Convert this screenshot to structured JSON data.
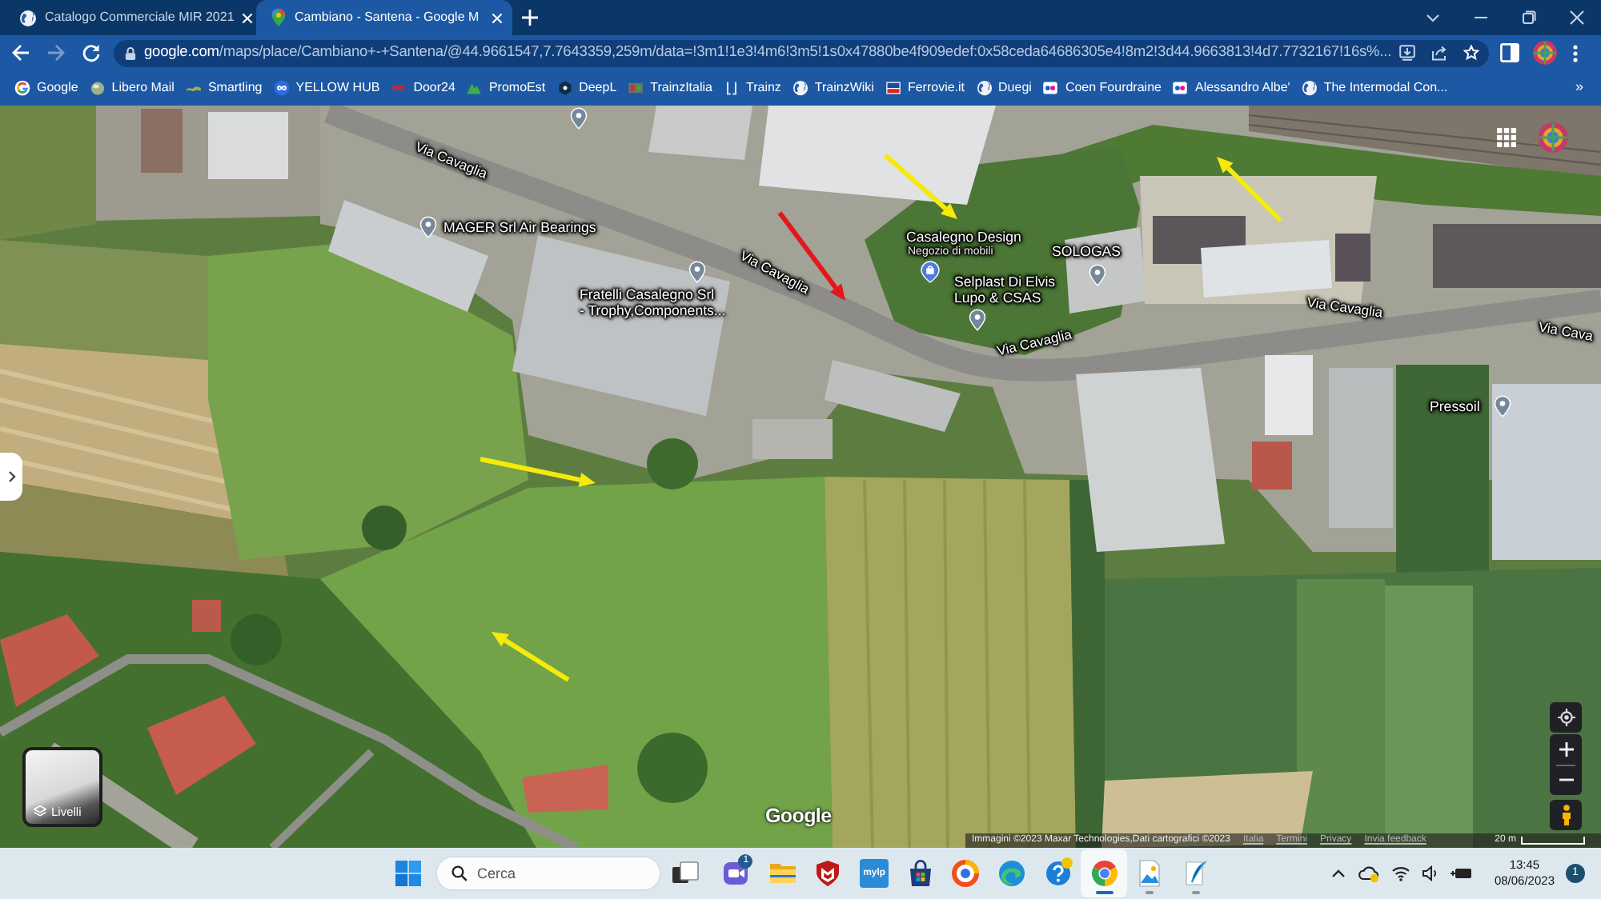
{
  "browser": {
    "tabs": [
      {
        "title": "Catalogo Commerciale MIR 2021",
        "selected": false
      },
      {
        "title": "Cambiano - Santena - Google M",
        "selected": true
      }
    ],
    "navigation": {
      "back_enabled": true,
      "forward_enabled": false
    },
    "address_bar": {
      "host": "google.com",
      "path": "/maps/place/Cambiano+-+Santena/@44.9661547,7.7643359,259m/data=!3m1!1e3!4m6!3m5!1s0x47880be4f909edef:0x58ceda64686305e4!8m2!3d44.9663813!4d7.7732167!16s%..."
    },
    "bookmarks": [
      {
        "label": "Google",
        "kind": "g"
      },
      {
        "label": "Libero Mail",
        "kind": "ball"
      },
      {
        "label": "Smartling",
        "kind": "bar"
      },
      {
        "label": "YELLOW HUB",
        "kind": "infinity_disc"
      },
      {
        "label": "Door24",
        "kind": "infinity"
      },
      {
        "label": "PromoEst",
        "kind": "triangle"
      },
      {
        "label": "DeepL",
        "kind": "hexagon"
      },
      {
        "label": "TrainzItalia",
        "kind": "image_tile"
      },
      {
        "label": "Trainz",
        "kind": "bracket"
      },
      {
        "label": "TrainzWiki",
        "kind": "globe"
      },
      {
        "label": "Ferrovie.it",
        "kind": "logo_tile"
      },
      {
        "label": "Duegi",
        "kind": "globe"
      },
      {
        "label": "Coen Fourdraine",
        "kind": "dots"
      },
      {
        "label": "Alessandro Albe'",
        "kind": "dots"
      },
      {
        "label": "The Intermodal Con...",
        "kind": "globe"
      }
    ],
    "bookmarks_more": "»"
  },
  "map": {
    "street_labels": [
      "Via Cavaglia",
      "Via Cavaglia",
      "Via Cavaglia",
      "Via Cavaglia",
      "Via Cava"
    ],
    "places": [
      {
        "kind": "pin"
      },
      {
        "kind": "pin",
        "name_lines": [
          "MAGER Srl Air Bearings"
        ]
      },
      {
        "kind": "pin",
        "name_lines": [
          "Fratelli Casalegno Srl",
          "- Trophy,Components..."
        ]
      },
      {
        "kind": "shop",
        "name_lines": [
          "Casalegno Design"
        ],
        "category": "Negozio di mobili"
      },
      {
        "kind": "pin",
        "name_lines": [
          "Selplast Di Elvis",
          "Lupo & CSAS"
        ]
      },
      {
        "kind": "pin",
        "name_lines": [
          "SOLOGAS"
        ]
      },
      {
        "kind": "pin",
        "name_lines": [
          "Pressoil"
        ]
      }
    ],
    "arrows": [
      {
        "color": "#f5ea0a"
      },
      {
        "color": "#e3171c"
      },
      {
        "color": "#f5ea0a"
      },
      {
        "color": "#f5ea0a"
      },
      {
        "color": "#f5ea0a"
      }
    ],
    "layers_button": {
      "label": "Livelli"
    },
    "logo": "Google",
    "attribution": {
      "imagery": "Immagini ©2023 Maxar Technologies,Dati cartografici ©2023",
      "links": [
        "Italia",
        "Termini",
        "Privacy",
        "Invia feedback"
      ],
      "scale": "20 m"
    }
  },
  "taskbar": {
    "search": {
      "placeholder": "Cerca"
    },
    "apps": [
      {
        "kind": "task_view",
        "selected": false,
        "running": false,
        "alert": false
      },
      {
        "kind": "chat",
        "badge": "1",
        "selected": false,
        "running": false,
        "alert": false
      },
      {
        "kind": "folder",
        "selected": false,
        "running": false,
        "alert": false
      },
      {
        "kind": "shield",
        "selected": false,
        "running": false,
        "alert": false
      },
      {
        "kind": "tile",
        "label": "mylp",
        "selected": false,
        "running": false,
        "alert": false
      },
      {
        "kind": "store",
        "selected": false,
        "running": false,
        "alert": false
      },
      {
        "kind": "ring",
        "selected": false,
        "running": false,
        "alert": false
      },
      {
        "kind": "swirl",
        "selected": false,
        "running": false,
        "alert": false
      },
      {
        "kind": "help",
        "selected": false,
        "running": false,
        "alert": true
      },
      {
        "kind": "browser",
        "selected": true,
        "running": true,
        "alert": false
      },
      {
        "kind": "image_file",
        "selected": false,
        "running": true,
        "alert": false
      },
      {
        "kind": "quill",
        "selected": false,
        "running": true,
        "alert": false
      }
    ],
    "clock": {
      "time": "13:45",
      "date": "08/06/2023"
    },
    "notifications": "1"
  }
}
